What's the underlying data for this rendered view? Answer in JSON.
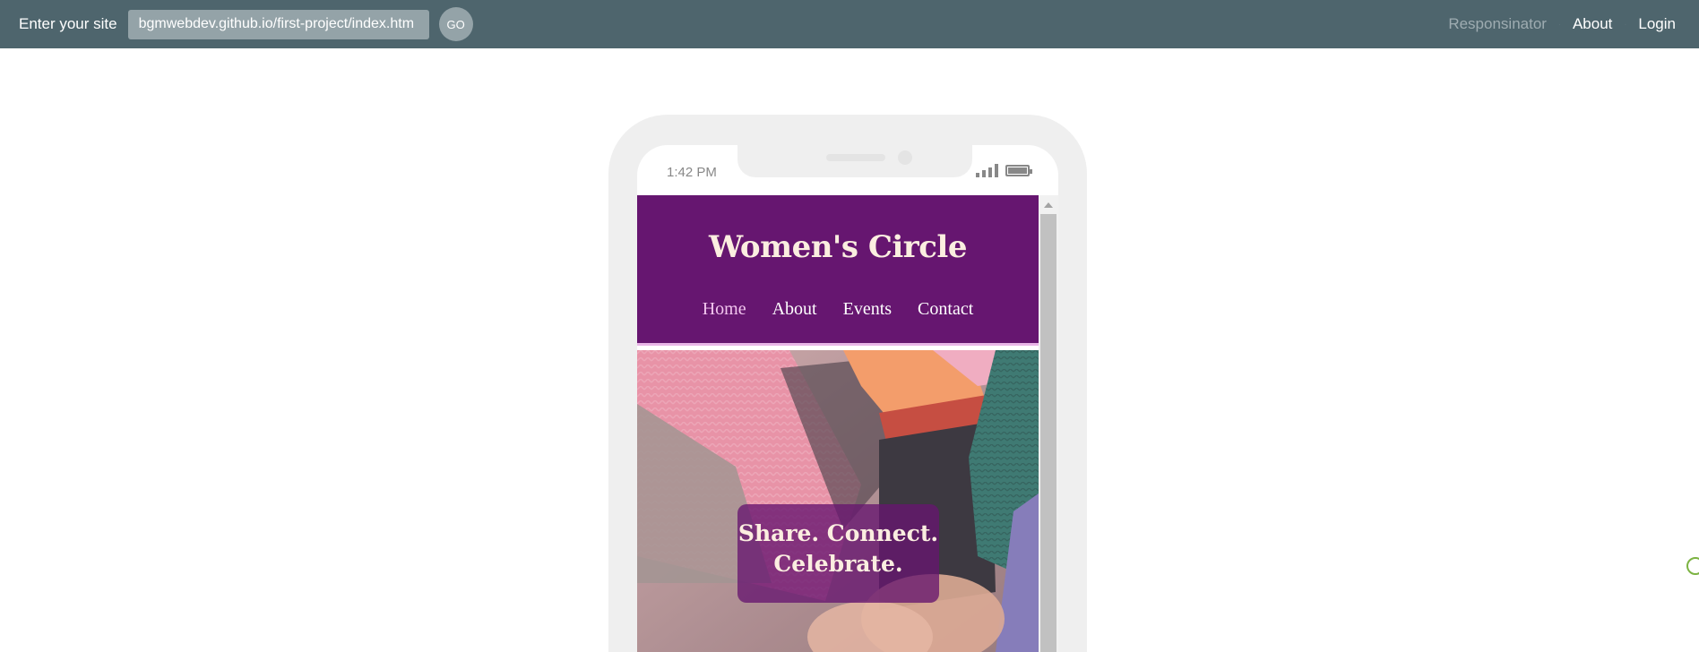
{
  "topbar": {
    "label": "Enter your site",
    "url_value": "bgmwebdev.github.io/first-project/index.htm",
    "go_label": "GO",
    "nav": {
      "brand": "Responsinator",
      "about": "About",
      "login": "Login"
    },
    "colors": {
      "background": "#4e656d",
      "input": "#94a3a8"
    }
  },
  "phone": {
    "status_bar": {
      "time": "1:42 PM",
      "signal_icon": "signal-bars-icon",
      "battery_icon": "battery-full-icon"
    }
  },
  "site": {
    "title": "Women's Circle",
    "nav": [
      {
        "label": "Home",
        "active": true
      },
      {
        "label": "About",
        "active": false
      },
      {
        "label": "Events",
        "active": false
      },
      {
        "label": "Contact",
        "active": false
      }
    ],
    "hero": {
      "tagline_line1": "Share. Connect.",
      "tagline_line2": "Celebrate."
    },
    "colors": {
      "header": "#661670",
      "title": "#fbeee0",
      "active_nav": "#f3c6ef"
    }
  }
}
